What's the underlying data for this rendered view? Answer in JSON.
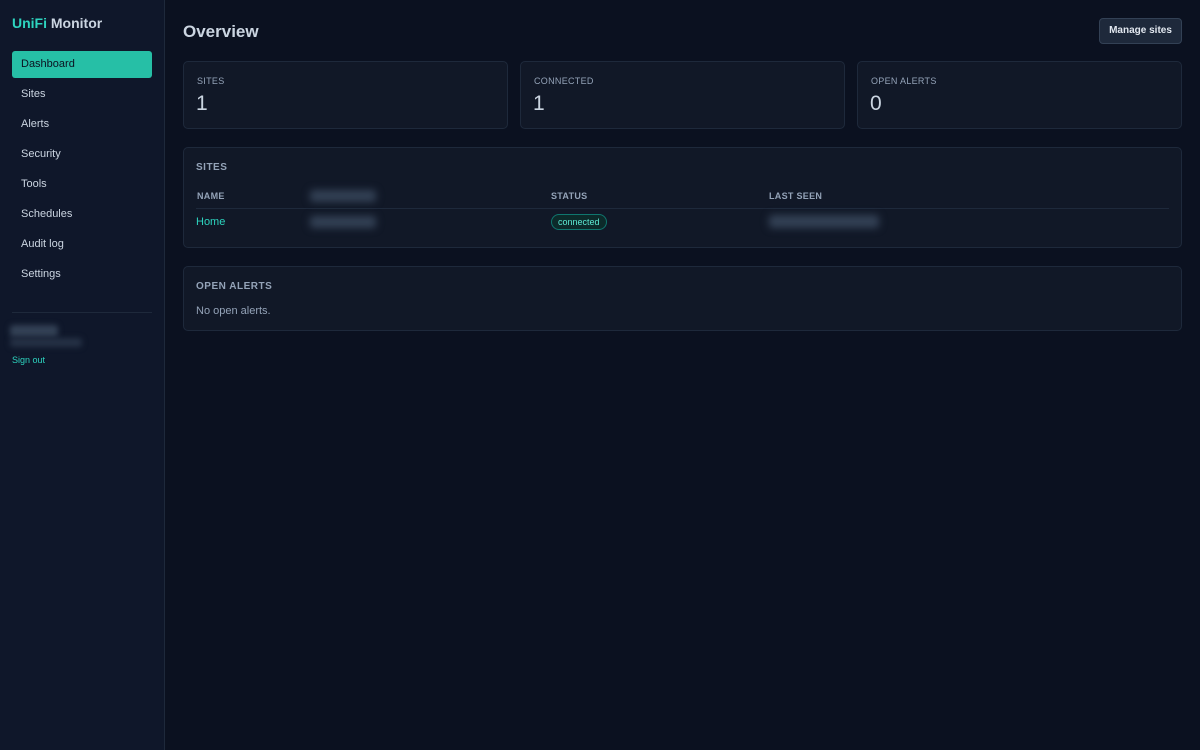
{
  "app": {
    "brand_accent": "UniFi",
    "brand_rest": " Monitor"
  },
  "sidebar": {
    "items": [
      {
        "label": "Dashboard",
        "active": true
      },
      {
        "label": "Sites"
      },
      {
        "label": "Alerts"
      },
      {
        "label": "Security"
      },
      {
        "label": "Tools"
      },
      {
        "label": "Schedules"
      },
      {
        "label": "Audit log"
      },
      {
        "label": "Settings"
      }
    ],
    "sign_out": "Sign out"
  },
  "header": {
    "title": "Overview",
    "manage_button": "Manage sites"
  },
  "stats": [
    {
      "label": "SITES",
      "value": "1"
    },
    {
      "label": "CONNECTED",
      "value": "1"
    },
    {
      "label": "OPEN ALERTS",
      "value": "0"
    }
  ],
  "sites_panel": {
    "title": "SITES",
    "columns": [
      "NAME",
      "STATUS",
      "LAST SEEN"
    ],
    "rows": [
      {
        "name": "Home",
        "status": "connected"
      }
    ]
  },
  "alerts_panel": {
    "title": "OPEN ALERTS",
    "empty_message": "No open alerts."
  },
  "colors": {
    "accent": "#2dd4bf",
    "active_nav": "#26bfa6",
    "background": "#0b1120",
    "panel": "#111827"
  }
}
